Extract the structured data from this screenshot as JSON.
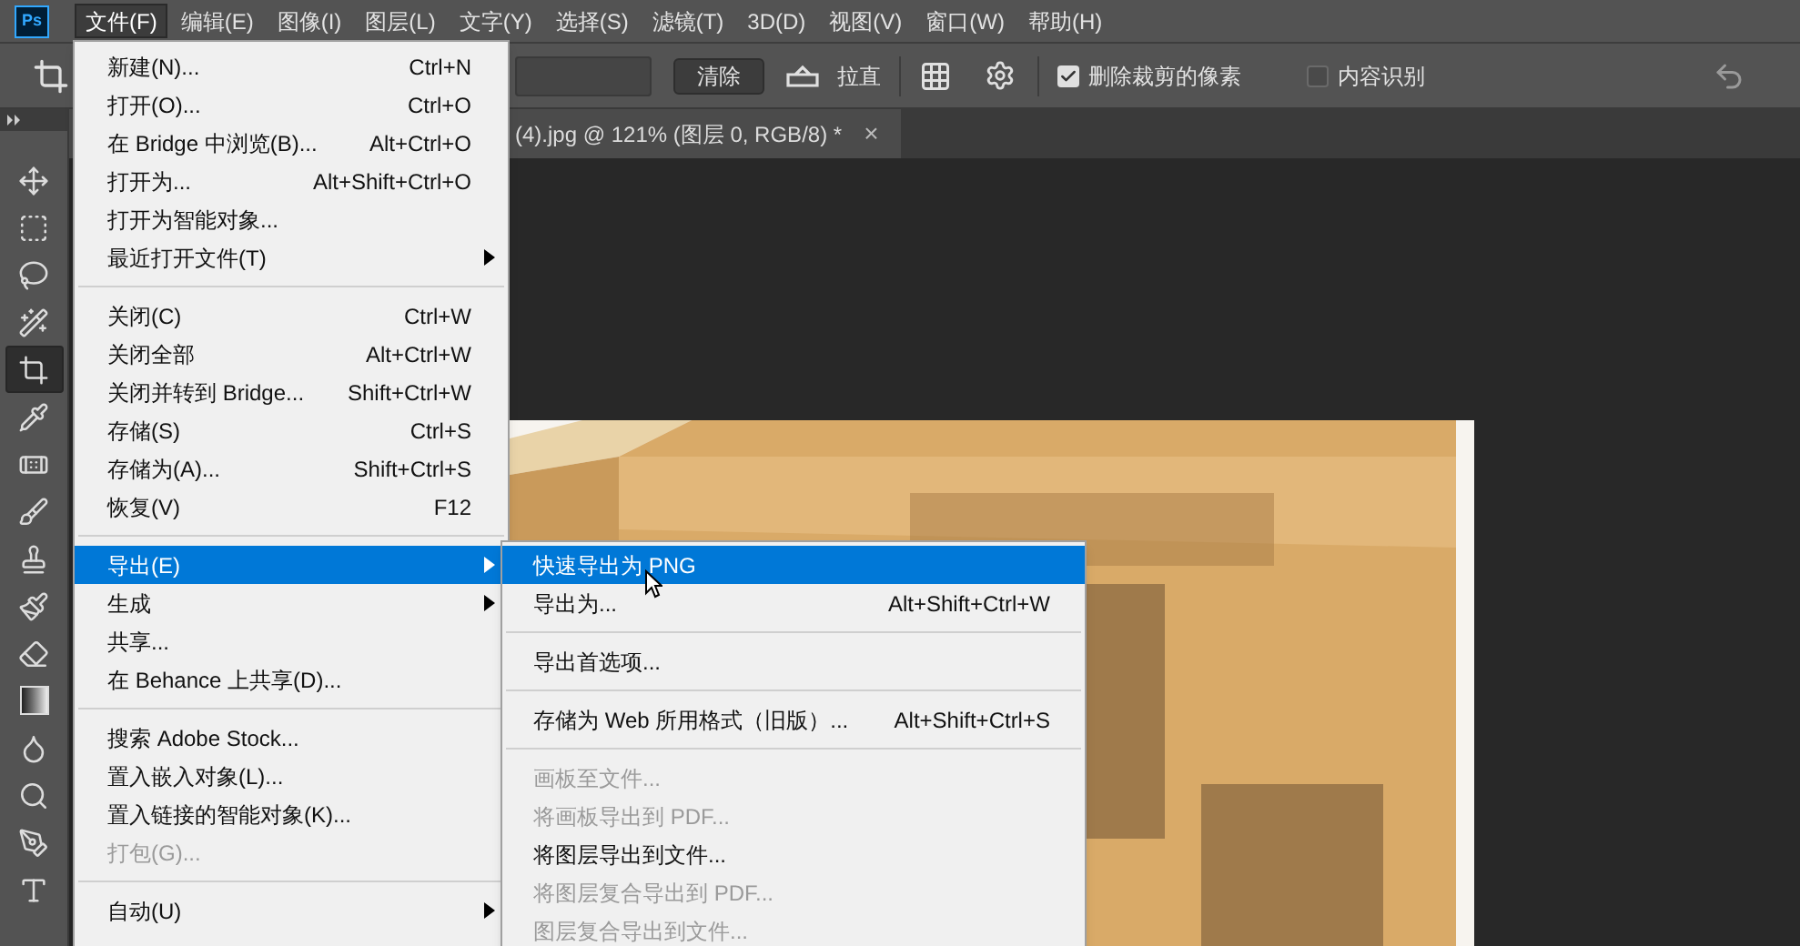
{
  "app_logo": "Ps",
  "menubar": [
    {
      "label": "文件(F)",
      "selected": true
    },
    {
      "label": "编辑(E)",
      "selected": false
    },
    {
      "label": "图像(I)",
      "selected": false
    },
    {
      "label": "图层(L)",
      "selected": false
    },
    {
      "label": "文字(Y)",
      "selected": false
    },
    {
      "label": "选择(S)",
      "selected": false
    },
    {
      "label": "滤镜(T)",
      "selected": false
    },
    {
      "label": "3D(D)",
      "selected": false
    },
    {
      "label": "视图(V)",
      "selected": false
    },
    {
      "label": "窗口(W)",
      "selected": false
    },
    {
      "label": "帮助(H)",
      "selected": false
    }
  ],
  "options_bar": {
    "clear_button": "清除",
    "straighten_label": "拉直",
    "checkboxes": [
      {
        "label": "删除裁剪的像素",
        "checked": true
      },
      {
        "label": "内容识别",
        "checked": false
      }
    ]
  },
  "tools": [
    {
      "kind": "move",
      "selected": false
    },
    {
      "kind": "marquee",
      "selected": false
    },
    {
      "kind": "lasso",
      "selected": false
    },
    {
      "kind": "quick-select",
      "selected": false
    },
    {
      "kind": "crop",
      "selected": true
    },
    {
      "kind": "eyedropper",
      "selected": false
    },
    {
      "kind": "healing",
      "selected": false
    },
    {
      "kind": "brush",
      "selected": false
    },
    {
      "kind": "stamp",
      "selected": false
    },
    {
      "kind": "history-brush",
      "selected": false
    },
    {
      "kind": "eraser",
      "selected": false
    },
    {
      "kind": "gradient",
      "selected": false
    },
    {
      "kind": "blur",
      "selected": false
    },
    {
      "kind": "dodge",
      "selected": false
    },
    {
      "kind": "pen",
      "selected": false
    },
    {
      "kind": "type",
      "selected": false
    }
  ],
  "document_tab": {
    "title": "(4).jpg @ 121% (图层 0, RGB/8) *",
    "close": "×"
  },
  "file_menu": [
    {
      "kind": "item",
      "label": "新建(N)...",
      "shortcut": "Ctrl+N",
      "submenu": false,
      "disabled": false,
      "selected": false
    },
    {
      "kind": "item",
      "label": "打开(O)...",
      "shortcut": "Ctrl+O",
      "submenu": false,
      "disabled": false,
      "selected": false
    },
    {
      "kind": "item",
      "label": "在 Bridge 中浏览(B)...",
      "shortcut": "Alt+Ctrl+O",
      "submenu": false,
      "disabled": false,
      "selected": false
    },
    {
      "kind": "item",
      "label": "打开为...",
      "shortcut": "Alt+Shift+Ctrl+O",
      "submenu": false,
      "disabled": false,
      "selected": false
    },
    {
      "kind": "item",
      "label": "打开为智能对象...",
      "submenu": false,
      "disabled": false,
      "selected": false
    },
    {
      "kind": "item",
      "label": "最近打开文件(T)",
      "submenu": true,
      "disabled": false,
      "selected": false
    },
    {
      "kind": "separator"
    },
    {
      "kind": "item",
      "label": "关闭(C)",
      "shortcut": "Ctrl+W",
      "submenu": false,
      "disabled": false,
      "selected": false
    },
    {
      "kind": "item",
      "label": "关闭全部",
      "shortcut": "Alt+Ctrl+W",
      "submenu": false,
      "disabled": false,
      "selected": false
    },
    {
      "kind": "item",
      "label": "关闭并转到 Bridge...",
      "shortcut": "Shift+Ctrl+W",
      "submenu": false,
      "disabled": false,
      "selected": false
    },
    {
      "kind": "item",
      "label": "存储(S)",
      "shortcut": "Ctrl+S",
      "submenu": false,
      "disabled": false,
      "selected": false
    },
    {
      "kind": "item",
      "label": "存储为(A)...",
      "shortcut": "Shift+Ctrl+S",
      "submenu": false,
      "disabled": false,
      "selected": false
    },
    {
      "kind": "item",
      "label": "恢复(V)",
      "shortcut": "F12",
      "submenu": false,
      "disabled": false,
      "selected": false
    },
    {
      "kind": "separator"
    },
    {
      "kind": "item",
      "label": "导出(E)",
      "submenu": true,
      "disabled": false,
      "selected": true
    },
    {
      "kind": "item",
      "label": "生成",
      "submenu": true,
      "disabled": false,
      "selected": false
    },
    {
      "kind": "item",
      "label": "共享...",
      "submenu": false,
      "disabled": false,
      "selected": false
    },
    {
      "kind": "item",
      "label": "在 Behance 上共享(D)...",
      "submenu": false,
      "disabled": false,
      "selected": false
    },
    {
      "kind": "separator"
    },
    {
      "kind": "item",
      "label": "搜索 Adobe Stock...",
      "submenu": false,
      "disabled": false,
      "selected": false
    },
    {
      "kind": "item",
      "label": "置入嵌入对象(L)...",
      "submenu": false,
      "disabled": false,
      "selected": false
    },
    {
      "kind": "item",
      "label": "置入链接的智能对象(K)...",
      "submenu": false,
      "disabled": false,
      "selected": false
    },
    {
      "kind": "item",
      "label": "打包(G)...",
      "submenu": false,
      "disabled": true,
      "selected": false
    },
    {
      "kind": "separator"
    },
    {
      "kind": "item",
      "label": "自动(U)",
      "submenu": true,
      "disabled": false,
      "selected": false
    }
  ],
  "export_submenu": [
    {
      "kind": "item",
      "label": "快速导出为 PNG",
      "disabled": false,
      "selected": true
    },
    {
      "kind": "item",
      "label": "导出为...",
      "shortcut": "Alt+Shift+Ctrl+W",
      "disabled": false,
      "selected": false
    },
    {
      "kind": "separator"
    },
    {
      "kind": "item",
      "label": "导出首选项...",
      "disabled": false,
      "selected": false
    },
    {
      "kind": "separator"
    },
    {
      "kind": "item",
      "label": "存储为 Web 所用格式（旧版）...",
      "shortcut": "Alt+Shift+Ctrl+S",
      "disabled": false,
      "selected": false
    },
    {
      "kind": "separator"
    },
    {
      "kind": "item",
      "label": "画板至文件...",
      "disabled": true,
      "selected": false
    },
    {
      "kind": "item",
      "label": "将画板导出到 PDF...",
      "disabled": true,
      "selected": false
    },
    {
      "kind": "item",
      "label": "将图层导出到文件...",
      "disabled": false,
      "selected": false
    },
    {
      "kind": "item",
      "label": "将图层复合导出到 PDF...",
      "disabled": true,
      "selected": false
    },
    {
      "kind": "item",
      "label": "图层复合导出到文件...",
      "disabled": true,
      "selected": false
    }
  ]
}
